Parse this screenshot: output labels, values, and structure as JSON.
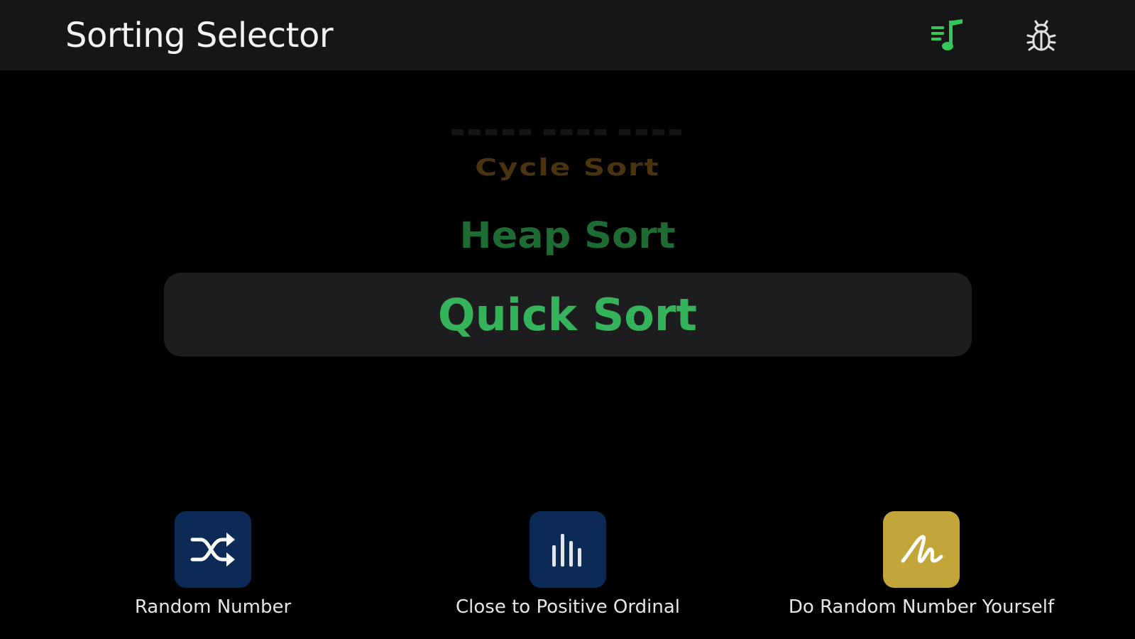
{
  "header": {
    "title": "Sorting Selector",
    "music_icon": "music-list-icon",
    "bug_icon": "bug-icon",
    "music_icon_color": "#34c759",
    "bug_icon_color": "#e0e0e0"
  },
  "picker": {
    "items": [
      {
        "label": "Cycle Sort",
        "color": "#4a3410",
        "position": "above-2"
      },
      {
        "label": "Heap Sort",
        "color": "#1f6b34",
        "position": "above-1"
      },
      {
        "label": "Quick Sort",
        "color": "#34b35a",
        "position": "selected"
      }
    ]
  },
  "actions": [
    {
      "label": "Random Number",
      "icon": "shuffle-icon",
      "bg": "#0b2a55"
    },
    {
      "label": "Close to Positive Ordinal",
      "icon": "bars-icon",
      "bg": "#0b2a55"
    },
    {
      "label": "Do Random Number Yourself",
      "icon": "signature-icon",
      "bg": "#c2a63a"
    }
  ]
}
